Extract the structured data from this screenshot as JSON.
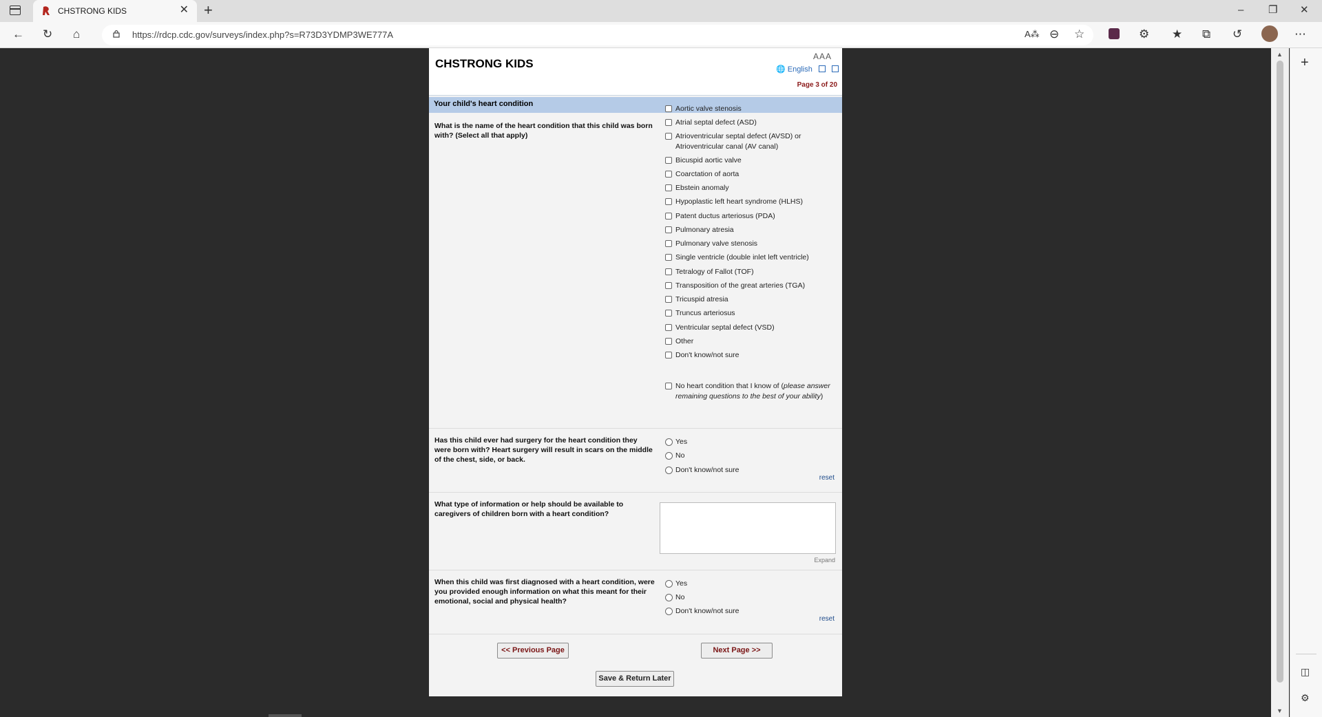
{
  "browser": {
    "tab_title": "CHSTRONG KIDS",
    "tab_close": "✕",
    "new_tab": "+",
    "url": "https://rdcp.cdc.gov/surveys/index.php?s=R73D3YDMP3WE777A",
    "window_controls": {
      "minimize": "–",
      "restore": "❐",
      "close": "✕"
    },
    "icons": [
      "back-icon",
      "refresh-icon",
      "home-icon",
      "read-aloud-icon",
      "zoom-out-icon",
      "add-favorite-icon",
      "extensions-icon",
      "favorites-icon",
      "collections-icon",
      "history-icon",
      "more-icon"
    ]
  },
  "survey": {
    "title": "CHSTRONG KIDS",
    "font_sizer": "AAA",
    "language": "English",
    "page_indicator": "Page 3 of 20",
    "section_title": "Your child's heart condition",
    "q1": {
      "text": "What is the name of the heart condition that this child was born with? (Select all that apply)",
      "options": [
        "Aortic valve stenosis",
        "Atrial septal defect (ASD)",
        "Atrioventricular septal defect (AVSD) or Atrioventricular canal (AV canal)",
        "Bicuspid aortic valve",
        "Coarctation of aorta",
        "Ebstein anomaly",
        "Hypoplastic left heart syndrome (HLHS)",
        "Patent ductus arteriosus (PDA)",
        "Pulmonary atresia",
        "Pulmonary valve stenosis",
        "Single ventricle (double inlet left ventricle)",
        "Tetralogy of Fallot (TOF)",
        "Transposition of the great arteries (TGA)",
        "Tricuspid atresia",
        "Truncus arteriosus",
        "Ventricular septal defect (VSD)",
        "Other",
        "Don't know/not sure"
      ],
      "last_option_prefix": "No heart condition that I know of (",
      "last_option_italic": "please answer remaining questions to the best of your ability",
      "last_option_suffix": ")"
    },
    "q2": {
      "text": "Has this child ever had surgery for the heart condition they were born with? Heart surgery will result in scars on the middle of the chest, side, or back.",
      "options": [
        "Yes",
        "No",
        "Don't know/not sure"
      ],
      "reset": "reset"
    },
    "q3": {
      "text": "What type of information or help should be available to caregivers of children born with a heart condition?",
      "expand": "Expand",
      "value": ""
    },
    "q4": {
      "text": "When this child was first diagnosed with a heart condition, were you provided enough information on what this meant for their emotional, social and physical health?",
      "options": [
        "Yes",
        "No",
        "Don't know/not sure"
      ],
      "reset": "reset"
    },
    "nav": {
      "previous": "<< Previous Page",
      "next": "Next Page >>",
      "save": "Save & Return Later"
    }
  },
  "colors": {
    "section_header_bg": "#b5cbe7",
    "page_indicator": "#8b1a1a",
    "link": "#2a6ab8",
    "page_background": "#2b2b2b"
  }
}
